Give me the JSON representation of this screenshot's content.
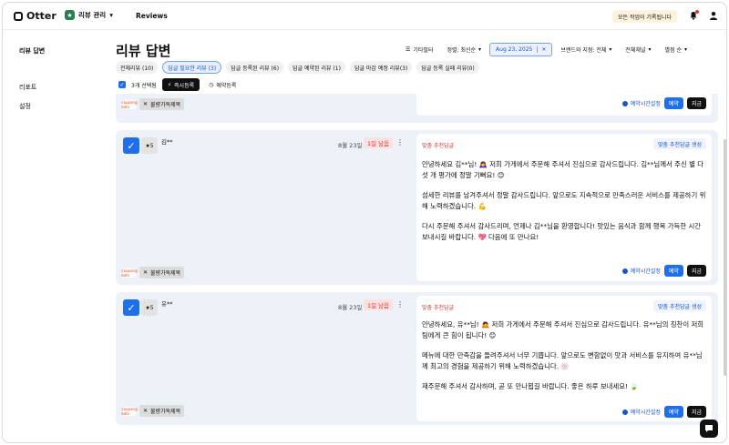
{
  "app": {
    "name": "Otter"
  },
  "header": {
    "store_menu": "리뷰 관리",
    "nav_reviews": "Reviews",
    "notice": "모든 작업이 기록됩니다"
  },
  "sidebar": {
    "items": [
      {
        "label": "리뷰 답변"
      },
      {
        "label": "리포트"
      },
      {
        "label": "설정"
      }
    ]
  },
  "page": {
    "title": "리뷰 답변"
  },
  "filters": {
    "other": "기타필터",
    "sort": "정렬: 최신순",
    "date": "Aug 23, 2025",
    "brand": "브랜드와 지점: 전체",
    "channel": "전체채널",
    "rating_sort": "별점 순"
  },
  "tabs": [
    {
      "label": "전체리뷰 (10)",
      "active": false
    },
    {
      "label": "답글 필요한 리뷰 (3)",
      "active": true
    },
    {
      "label": "답글 등록된 리뷰 (6)",
      "active": false
    },
    {
      "label": "답글 예약된 리뷰 (1)",
      "active": false
    },
    {
      "label": "답글 마감 예정 리뷰(3)",
      "active": false
    },
    {
      "label": "답글 등록 실패 리뷰(0)",
      "active": false
    }
  ],
  "selection": {
    "count_label": "3개 선택됨",
    "instant_register": "즉시등록",
    "schedule_register": "예약등록"
  },
  "cards": [
    {
      "platform": "coupang eats",
      "complaint_label": "불량가독제목",
      "schedule_label": "예약시간설정",
      "reserve": "예약",
      "now": "지금"
    },
    {
      "rating": "★5",
      "author": "김**",
      "date": "8월 23일",
      "badge": "1일 남음",
      "reply_title": "맞춤 추천답글",
      "generate": "맞춤 추천답글 생성",
      "paragraphs": [
        "안녕하세요 김**님! 🙇‍♀️ 저희 가게에서 주문해 주셔서 진심으로 감사드립니다. 김**님께서 주신 별 다섯 개 평가에 정말 기뻐요! 😊",
        "섬세한 리뷰를 남겨주셔서 정말 감사드립니다. 앞으로도 지속적으로 만족스러운 서비스를 제공하기 위해 노력하겠습니다. 💪",
        "다시 주문해 주셔서 감사드리며, 언제나 김**님을 환영합니다! 맛있는 음식과 함께 행복 가득한 시간 보내시길 바랍니다. 💖 다음에 또 만나요!"
      ],
      "platform": "coupang eats",
      "complaint_label": "불량가독제목",
      "schedule_label": "예약시간설정",
      "reserve": "예약",
      "now": "지금"
    },
    {
      "rating": "★5",
      "author": "유**",
      "date": "8월 23일",
      "badge": "1일 남음",
      "reply_title": "맞춤 추천답글",
      "generate": "맞춤 추천답글 생성",
      "paragraphs": [
        "안녕하세요, 유**님! 🙇 저희 가게에서 주문해 주셔서 진심으로 감사드립니다. 유**님의 칭찬이 저희 팀에게 큰 힘이 됩니다! 😊",
        "메뉴에 대한 만족감을 들려주셔서 너무 기쁩니다. 앞으로도 변함없이 맛과 서비스를 유지하여 유**님께 최고의 경험을 제공하기 위해 노력하겠습니다. 🍥",
        "재주문해 주셔서 감사하며, 곧 또 만나뵙길 바랍니다. 좋은 하루 보내세요! 🍃"
      ],
      "platform": "coupang eats",
      "complaint_label": "불량가독제목",
      "schedule_label": "예약시간설정",
      "reserve": "예약",
      "now": "지금"
    }
  ],
  "colors": {
    "primary": "#1f6feb",
    "card_bg": "#edf1f8",
    "badge_red": "#d33333",
    "notice_bg": "#fdf3dc"
  }
}
